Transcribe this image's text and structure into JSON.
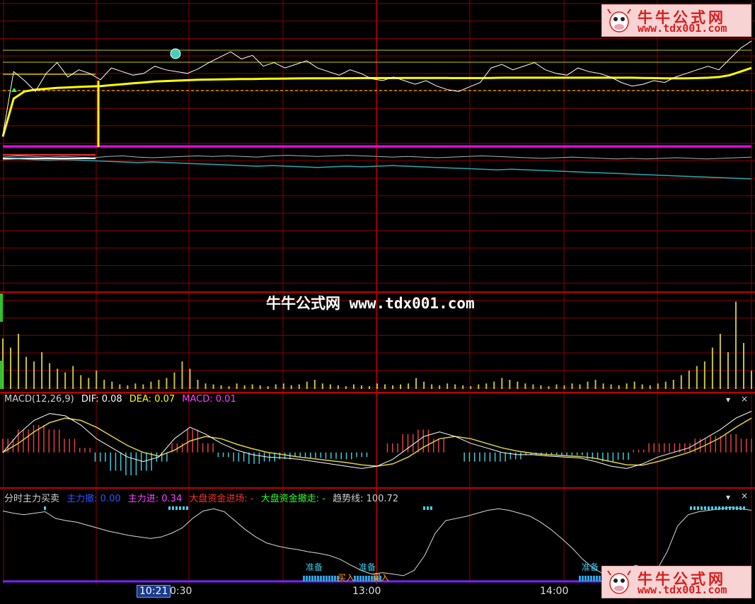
{
  "watermark": {
    "name": "牛牛公式网",
    "url": "www.tdx001.com",
    "center_text": "牛牛公式网 www.tdx001.com"
  },
  "colors": {
    "grid": "#8b0000",
    "price": "#ffffff",
    "avg": "#ffff00",
    "magenta": "#ff00ff",
    "teal": "#2aa8b0",
    "macd_up": "#e04040",
    "macd_down": "#40c8d8",
    "dea": "#e0d040",
    "volume": "#c8c040"
  },
  "macd": {
    "title": "MACD(12,26,9)",
    "dif_label": "DIF: 0.08",
    "dea_label": "DEA: 0.07",
    "macd_label": "MACD: 0.01"
  },
  "indicator": {
    "title": "分时主力买卖",
    "zl_out": "主力撤: 0.00",
    "zl_in": "主力进: 0.34",
    "dp_in": "大盘资金进场: -",
    "dp_out": "大盘资金撤走: -",
    "trend": "趋势线: 100.72",
    "markers": [
      "准备",
      "准备",
      "准备",
      "买入",
      "买入"
    ]
  },
  "time_axis": {
    "cursor": "10:21",
    "labels": [
      "0:30",
      "13:00",
      "14:00"
    ]
  },
  "panel_controls": {
    "dropdown": "▾",
    "close": "×"
  },
  "chart_data": [
    {
      "type": "line",
      "title": "",
      "series": [
        {
          "values": [
            0.02,
            0.72,
            0.62,
            0.5,
            0.7,
            0.82,
            0.66,
            0.74,
            0.7,
            0.63,
            0.76,
            0.72,
            0.68,
            0.7,
            0.78,
            0.74,
            0.72,
            0.7,
            0.75,
            0.82,
            0.88,
            0.94,
            0.86,
            0.9,
            0.78,
            0.82,
            0.76,
            0.8,
            0.84,
            0.76,
            0.72,
            0.68,
            0.74,
            0.7,
            0.64,
            0.62,
            0.66,
            0.62,
            0.58,
            0.62,
            0.56,
            0.52,
            0.5,
            0.55,
            0.6,
            0.76,
            0.8,
            0.74,
            0.78,
            0.82,
            0.74,
            0.7,
            0.68,
            0.76,
            0.72,
            0.7,
            0.66,
            0.6,
            0.56,
            0.58,
            0.62,
            0.6,
            0.66,
            0.7,
            0.74,
            0.78,
            0.74,
            0.86,
            0.98,
            1.06
          ]
        },
        {
          "values": [
            0.0,
            0.42,
            0.5,
            0.52,
            0.53,
            0.54,
            0.545,
            0.55,
            0.555,
            0.56,
            0.57,
            0.58,
            0.59,
            0.6,
            0.61,
            0.615,
            0.62,
            0.625,
            0.63,
            0.632,
            0.634,
            0.636,
            0.637,
            0.638,
            0.64,
            0.642,
            0.643,
            0.644,
            0.645,
            0.646,
            0.646,
            0.647,
            0.647,
            0.648,
            0.648,
            0.648,
            0.648,
            0.649,
            0.649,
            0.649,
            0.649,
            0.649,
            0.648,
            0.648,
            0.648,
            0.65,
            0.652,
            0.652,
            0.652,
            0.652,
            0.652,
            0.652,
            0.652,
            0.652,
            0.652,
            0.652,
            0.652,
            0.652,
            0.652,
            0.65,
            0.648,
            0.646,
            0.645,
            0.646,
            0.648,
            0.652,
            0.66,
            0.68,
            0.72,
            0.76
          ]
        }
      ]
    },
    {
      "type": "line",
      "series": [
        {
          "values": [
            0.2,
            0.22,
            0.21,
            0.2,
            0.21,
            0.2,
            0.19,
            0.21,
            0.22,
            0.2,
            0.19,
            0.2,
            0.21,
            0.22,
            0.21,
            0.22,
            0.21,
            0.2,
            0.22,
            0.23,
            0.22,
            0.21,
            0.22,
            0.23,
            0.22,
            0.21,
            0.2,
            0.21,
            0.2,
            0.19,
            0.2,
            0.21,
            0.22,
            0.21,
            0.2,
            0.19,
            0.18,
            0.19,
            0.2,
            0.19,
            0.18,
            0.17,
            0.18,
            0.17,
            0.18,
            0.19,
            0.18,
            0.17,
            0.18,
            0.19,
            0.2
          ]
        },
        {
          "values": [
            0.16,
            0.17,
            0.16,
            0.15,
            0.16,
            0.15,
            0.14,
            0.13,
            0.12,
            0.11,
            0.12,
            0.11,
            0.1,
            0.09,
            0.08,
            0.07,
            0.06,
            0.05,
            0.06,
            0.05,
            0.04,
            0.03,
            0.04,
            0.05,
            0.04,
            0.05,
            0.06,
            0.05,
            0.04,
            0.03,
            0.02,
            0.01,
            0.0,
            -0.01,
            0.0,
            -0.01,
            -0.02,
            -0.03,
            -0.04,
            -0.05,
            -0.06,
            -0.07,
            -0.08,
            -0.09,
            -0.1,
            -0.11,
            -0.12,
            -0.13,
            -0.14,
            -0.15,
            -0.16
          ]
        }
      ]
    },
    {
      "type": "bar",
      "title": "",
      "values": [
        0.55,
        0.45,
        0.6,
        0.35,
        0.3,
        0.4,
        0.28,
        0.22,
        0.18,
        0.25,
        0.15,
        0.12,
        0.2,
        0.1,
        0.08,
        0.05,
        0.04,
        0.06,
        0.05,
        0.08,
        0.1,
        0.12,
        0.18,
        0.3,
        0.22,
        0.1,
        0.06,
        0.05,
        0.04,
        0.03,
        0.06,
        0.04,
        0.05,
        0.04,
        0.03,
        0.05,
        0.06,
        0.04,
        0.05,
        0.08,
        0.1,
        0.06,
        0.05,
        0.04,
        0.03,
        0.05,
        0.04,
        0.03,
        0.06,
        0.05,
        0.04,
        0.05,
        0.06,
        0.12,
        0.08,
        0.05,
        0.04,
        0.06,
        0.05,
        0.04,
        0.03,
        0.05,
        0.06,
        0.08,
        0.12,
        0.1,
        0.08,
        0.06,
        0.05,
        0.04,
        0.03,
        0.05,
        0.04,
        0.06,
        0.05,
        0.08,
        0.1,
        0.06,
        0.05,
        0.04,
        0.06,
        0.08,
        0.05,
        0.04,
        0.06,
        0.08,
        0.1,
        0.15,
        0.2,
        0.25,
        0.3,
        0.45,
        0.6,
        0.4,
        0.95,
        0.5,
        0.2
      ]
    },
    {
      "type": "line",
      "title": "MACD(12,26,9)",
      "series": [
        {
          "name": "DIF",
          "values": [
            0.0,
            0.4,
            0.7,
            0.85,
            0.8,
            0.6,
            0.3,
            0.1,
            -0.1,
            -0.2,
            -0.1,
            0.3,
            0.55,
            0.4,
            0.2,
            0.05,
            -0.05,
            -0.1,
            -0.12,
            -0.15,
            -0.2,
            -0.25,
            -0.3,
            -0.35,
            -0.3,
            -0.15,
            0.1,
            0.35,
            0.45,
            0.35,
            0.2,
            0.1,
            0.0,
            -0.05,
            -0.05,
            -0.08,
            -0.1,
            -0.12,
            -0.2,
            -0.3,
            -0.35,
            -0.25,
            -0.1,
            0.0,
            0.1,
            0.3,
            0.5,
            0.75,
            0.9
          ]
        },
        {
          "name": "DEA",
          "values": [
            0.0,
            0.2,
            0.45,
            0.65,
            0.75,
            0.7,
            0.55,
            0.35,
            0.15,
            0.0,
            -0.08,
            0.05,
            0.25,
            0.35,
            0.3,
            0.18,
            0.08,
            0.0,
            -0.05,
            -0.1,
            -0.14,
            -0.18,
            -0.22,
            -0.27,
            -0.3,
            -0.25,
            -0.1,
            0.12,
            0.3,
            0.35,
            0.3,
            0.2,
            0.1,
            0.03,
            -0.02,
            -0.05,
            -0.07,
            -0.09,
            -0.13,
            -0.2,
            -0.27,
            -0.28,
            -0.2,
            -0.1,
            0.0,
            0.15,
            0.32,
            0.55,
            0.75
          ]
        }
      ],
      "bars": [
        0.3,
        0.5,
        0.6,
        0.5,
        0.3,
        0.1,
        -0.2,
        -0.4,
        -0.5,
        -0.4,
        -0.2,
        0.2,
        0.5,
        0.2,
        -0.1,
        -0.2,
        -0.25,
        -0.2,
        -0.15,
        -0.1,
        -0.12,
        -0.14,
        -0.15,
        -0.1,
        0.0,
        0.2,
        0.4,
        0.5,
        0.3,
        0.0,
        -0.2,
        -0.2,
        -0.2,
        -0.15,
        -0.06,
        -0.06,
        -0.06,
        -0.06,
        -0.14,
        -0.2,
        -0.16,
        0.06,
        0.2,
        0.2,
        0.2,
        0.3,
        0.36,
        0.4,
        0.3
      ]
    },
    {
      "type": "line",
      "title": "分时主力买卖",
      "series": [
        {
          "name": "趋势线",
          "values": [
            0.85,
            0.82,
            0.8,
            0.82,
            0.84,
            0.75,
            0.72,
            0.7,
            0.66,
            0.62,
            0.58,
            0.55,
            0.52,
            0.5,
            0.48,
            0.5,
            0.55,
            0.62,
            0.75,
            0.85,
            0.88,
            0.84,
            0.72,
            0.6,
            0.5,
            0.42,
            0.38,
            0.35,
            0.33,
            0.3,
            0.28,
            0.25,
            0.2,
            0.12,
            0.05,
            0.0,
            0.02,
            0.0,
            -0.02,
            0.05,
            0.25,
            0.55,
            0.72,
            0.75,
            0.78,
            0.82,
            0.86,
            0.88,
            0.86,
            0.82,
            0.78,
            0.7,
            0.6,
            0.48,
            0.35,
            0.2,
            0.08,
            0.0,
            -0.02,
            0.05,
            0.12,
            0.08,
            0.05,
            0.3,
            0.65,
            0.8,
            0.84,
            0.86,
            0.88,
            0.9,
            0.88,
            0.86
          ]
        }
      ]
    }
  ]
}
